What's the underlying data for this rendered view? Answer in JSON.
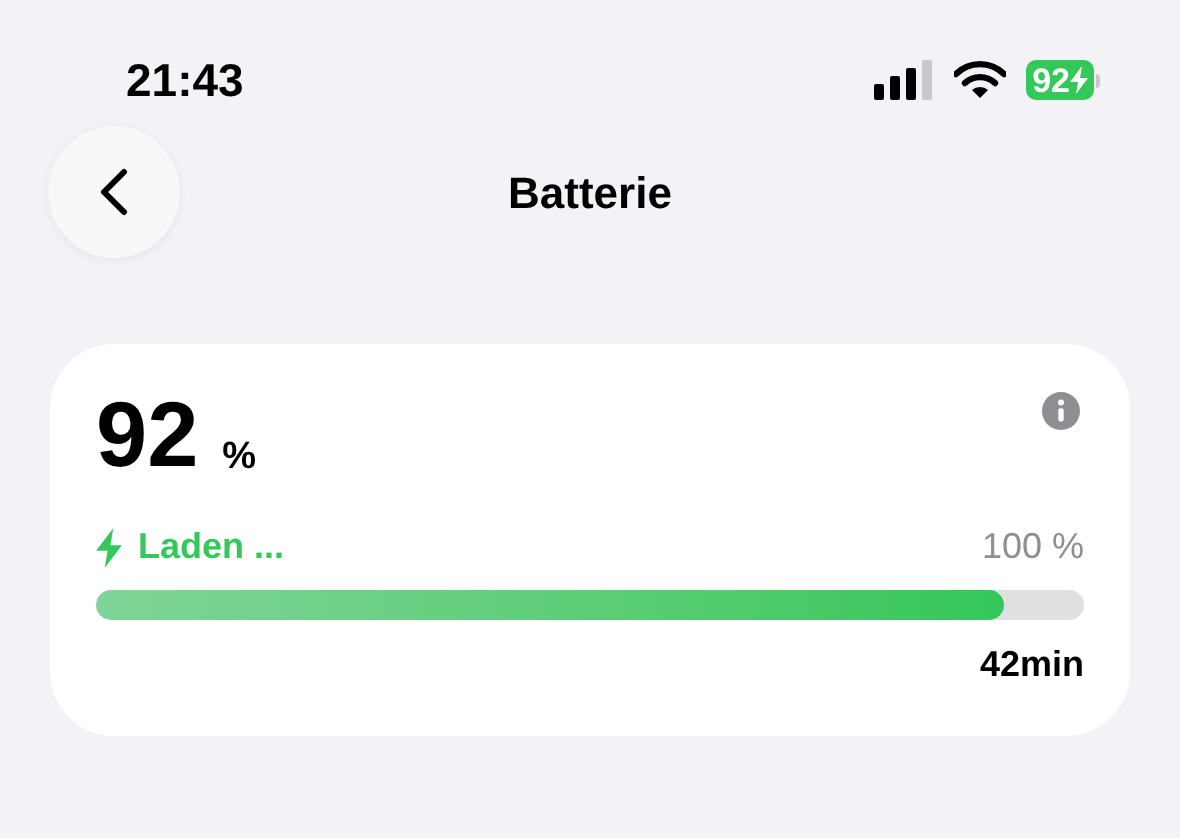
{
  "status_bar": {
    "time": "21:43",
    "battery": "92"
  },
  "nav": {
    "title": "Batterie"
  },
  "battery_card": {
    "percent": "92",
    "unit": "%",
    "status": "Laden ...",
    "limit": "100 %",
    "level": 0.92,
    "remaining": "42min"
  }
}
